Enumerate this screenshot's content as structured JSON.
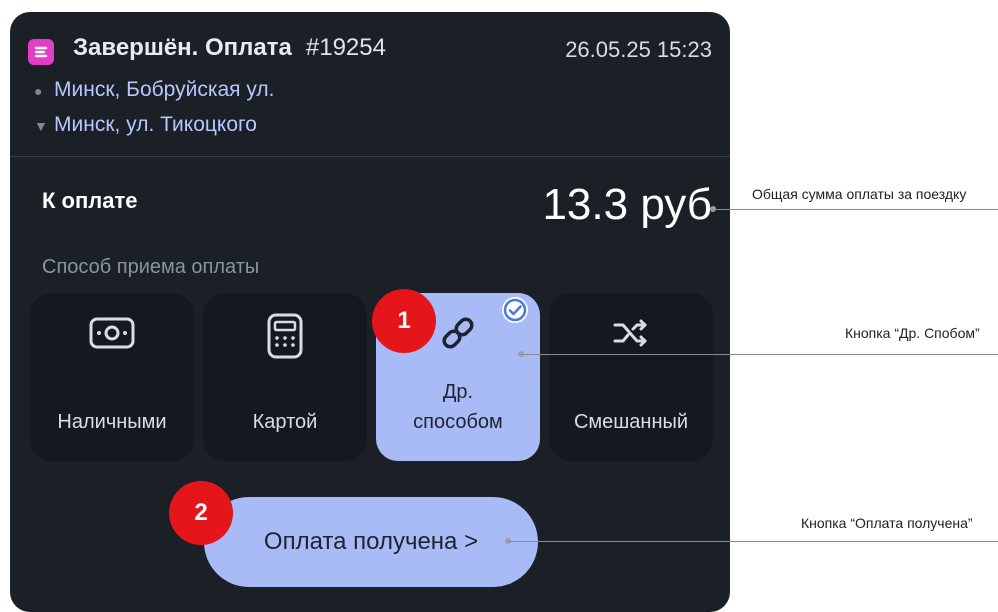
{
  "order": {
    "status": "Завершён. Оплата",
    "number": "#19254",
    "datetime": "26.05.25 15:23",
    "route_from": "Минск, Бобруйская ул.",
    "route_to": "Минск, ул. Тикоцкого"
  },
  "payment": {
    "label": "К оплате",
    "amount": "13.3 руб",
    "method_title": "Способ приема оплаты",
    "methods": [
      {
        "label": "Наличными",
        "icon": "cash-icon",
        "selected": false
      },
      {
        "label": "Картой",
        "icon": "card-terminal-icon",
        "selected": false
      },
      {
        "label": "Др. способом",
        "icon": "link-icon",
        "selected": true
      },
      {
        "label": "Смешанный",
        "icon": "shuffle-icon",
        "selected": false
      }
    ],
    "confirm_button": "Оплата получена >"
  },
  "badges": [
    "1",
    "2"
  ],
  "callouts": {
    "total": "Общая сумма оплаты за поездку",
    "other_method": "Кнопка “Др. Спобом”",
    "payment_received": "Кнопка “Оплата получена”"
  },
  "colors": {
    "card_background": "#1b1f26",
    "tile_background": "#131821",
    "accent": "#a9bbf6",
    "logo": "#e23dc6",
    "badge": "#e4161c",
    "route_text": "#b6c7ff"
  }
}
